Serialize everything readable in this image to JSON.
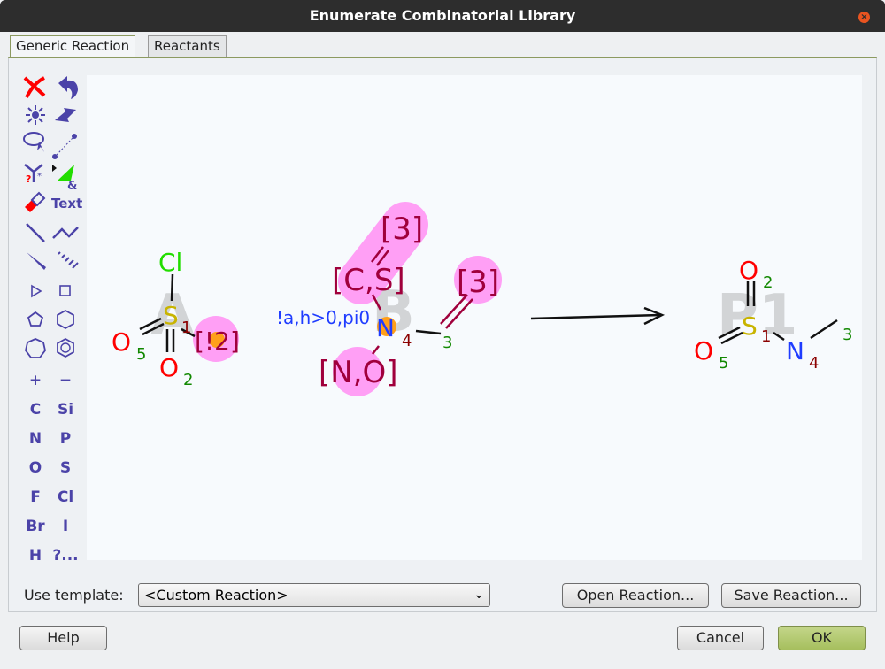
{
  "window": {
    "title": "Enumerate Combinatorial Library",
    "close_icon": "close-icon"
  },
  "tabs": [
    {
      "label": "Generic Reaction",
      "active": true
    },
    {
      "label": "Reactants",
      "active": false
    }
  ],
  "toolbar": {
    "text_tool": "Text",
    "atoms": [
      "+",
      "−",
      "C",
      "Si",
      "N",
      "P",
      "O",
      "S",
      "F",
      "Cl",
      "Br",
      "I",
      "H",
      "?..."
    ],
    "icons": [
      "delete-icon",
      "undo-icon",
      "clean-icon",
      "flip-icon",
      "lasso-select-icon",
      "distance-icon",
      "r-group-query-icon",
      "reaction-mapping-icon",
      "eraser-icon",
      "text-icon",
      "single-bond-icon",
      "chain-icon",
      "wedge-bond-icon",
      "hash-bond-icon",
      "triangle-icon",
      "square-icon",
      "pentagon-icon",
      "hexagon-icon",
      "heptagon-icon",
      "benzene-icon"
    ]
  },
  "reaction": {
    "reactant_a": {
      "label": "A",
      "atoms": {
        "cl": "Cl",
        "s": "S",
        "s_map": "1",
        "o5": "O",
        "o5_map": "5",
        "o2": "O",
        "o2_map": "2",
        "q": "[!2]"
      }
    },
    "reactant_b": {
      "label": "B",
      "atoms": {
        "q3a": "[3]",
        "cs": "[C,S]",
        "n": "N",
        "n_map": "4",
        "n_query": "!a,h>0,pi0",
        "no": "[N,O]",
        "c_map": "3",
        "q3b": "[3]"
      }
    },
    "product": {
      "label": "P1",
      "atoms": {
        "o2": "O",
        "o2_map": "2",
        "s": "S",
        "s_map": "1",
        "o5": "O",
        "o5_map": "5",
        "n": "N",
        "n_map": "4",
        "c_map": "3"
      }
    },
    "colors": {
      "highlight": "#ff9ff5",
      "map_dot": "#ff9f1a",
      "query": "#a0003c",
      "n": "#1f3cff",
      "o": "#ff0000",
      "s": "#c8b400",
      "cl": "#22dd00",
      "map_num": "#118800",
      "map_num2": "#8b0000"
    }
  },
  "template": {
    "label": "Use template:",
    "value": "<Custom Reaction>"
  },
  "buttons": {
    "open": "Open Reaction...",
    "save": "Save Reaction...",
    "help": "Help",
    "cancel": "Cancel",
    "ok": "OK"
  }
}
